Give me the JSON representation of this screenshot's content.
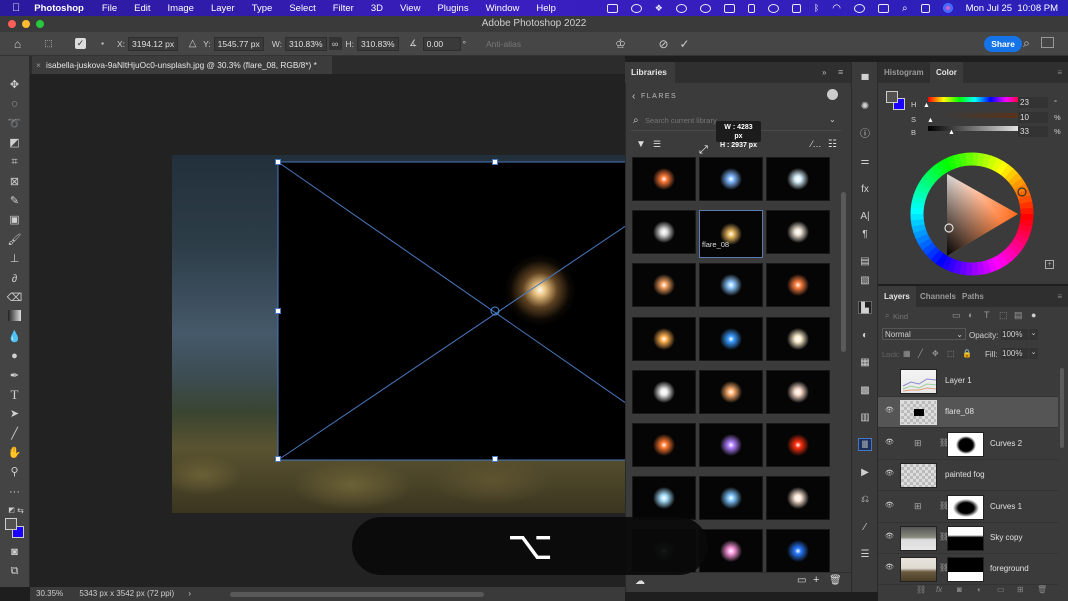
{
  "menubar": {
    "app_name": "Photoshop",
    "items": [
      "File",
      "Edit",
      "Image",
      "Layer",
      "Type",
      "Select",
      "Filter",
      "3D",
      "View",
      "Plugins",
      "Window",
      "Help"
    ],
    "tray_icons": [
      "screen-record-icon",
      "creative-cloud-icon",
      "dropbox-icon",
      "vpn-icon",
      "screen-time-icon",
      "airplay-icon",
      "bookmark-icon",
      "cloud-icon",
      "stage-manager-icon",
      "bluetooth-icon",
      "wifi-icon",
      "user-icon",
      "display-icon",
      "spotlight-icon",
      "control-center-icon",
      "siri-icon"
    ],
    "datetime": "Mon Jul 25  10:08 PM"
  },
  "window": {
    "title": "Adobe Photoshop 2022"
  },
  "options_bar": {
    "x_label": "X:",
    "x_value": "3194.12 px",
    "y_label": "Y:",
    "y_value": "1545.77 px",
    "w_label": "W:",
    "w_value": "310.83%",
    "h_label": "H:",
    "h_value": "310.83%",
    "angle_value": "0.00",
    "angle_unit": "°",
    "antialias_label": "Anti-alias",
    "share_label": "Share"
  },
  "document": {
    "tab_title": "isabella-juskova-9aNltHjuOc0-unsplash.jpg @ 30.3% (flare_08, RGB/8*) *",
    "zoom": "30.35%",
    "dimensions": "5343 px x 3542 px (72 ppi)"
  },
  "overlay": {
    "key_symbol": "⌥"
  },
  "libraries": {
    "tab_label": "Libraries",
    "breadcrumb": "FLARES",
    "search_placeholder": "Search current library",
    "tooltip_w": "W : 4283 px",
    "tooltip_h": "H : 2937 px",
    "selected_label": "flare_08",
    "thumbs": [
      {
        "color": "#ff7a3a"
      },
      {
        "color": "#7fb8ff"
      },
      {
        "color": "#d9f2ff"
      },
      {
        "color": "#e0e0e0"
      },
      {
        "color": "#e8b860"
      },
      {
        "color": "#f0e6d8"
      },
      {
        "color": "#f0a060"
      },
      {
        "color": "#8cc8ff"
      },
      {
        "color": "#ff8040"
      },
      {
        "color": "#ffb050"
      },
      {
        "color": "#3a9cff"
      },
      {
        "color": "#fff0d0"
      },
      {
        "color": "#f0f0f0"
      },
      {
        "color": "#ffb070"
      },
      {
        "color": "#ffe0d0"
      },
      {
        "color": "#ff7a30"
      },
      {
        "color": "#b080ff"
      },
      {
        "color": "#ff3010"
      },
      {
        "color": "#a8e0ff"
      },
      {
        "color": "#80c8ff"
      },
      {
        "color": "#ffe8d8"
      },
      {
        "color": "#4a6a70"
      },
      {
        "color": "#ff9ae0"
      },
      {
        "color": "#2a7aff"
      }
    ]
  },
  "color_panel": {
    "tabs": [
      "Histogram",
      "Color"
    ],
    "active_tab": "Color",
    "h_label": "H",
    "h_value": "23",
    "h_unit": "°",
    "s_label": "S",
    "s_value": "10",
    "s_unit": "%",
    "b_label": "B",
    "b_value": "33",
    "b_unit": "%",
    "foreground_color": "#545250",
    "background_color": "#1a00ff"
  },
  "layers_panel": {
    "tabs": [
      "Layers",
      "Channels",
      "Paths"
    ],
    "active_tab": "Layers",
    "filter_placeholder": "Kind",
    "blend_mode": "Normal",
    "opacity_label": "Opacity:",
    "opacity_value": "100%",
    "lock_label": "Lock:",
    "fill_label": "Fill:",
    "fill_value": "100%",
    "layers": [
      {
        "name": "Layer 1",
        "visible": false,
        "selected": false,
        "type": "pixel"
      },
      {
        "name": "flare_08",
        "visible": true,
        "selected": true,
        "type": "smart"
      },
      {
        "name": "Curves 2",
        "visible": true,
        "selected": false,
        "type": "adjustment"
      },
      {
        "name": "painted fog",
        "visible": true,
        "selected": false,
        "type": "pixel"
      },
      {
        "name": "Curves 1",
        "visible": true,
        "selected": false,
        "type": "adjustment"
      },
      {
        "name": "Sky copy",
        "visible": true,
        "selected": false,
        "type": "masked"
      },
      {
        "name": "foreground",
        "visible": true,
        "selected": false,
        "type": "masked"
      }
    ]
  }
}
